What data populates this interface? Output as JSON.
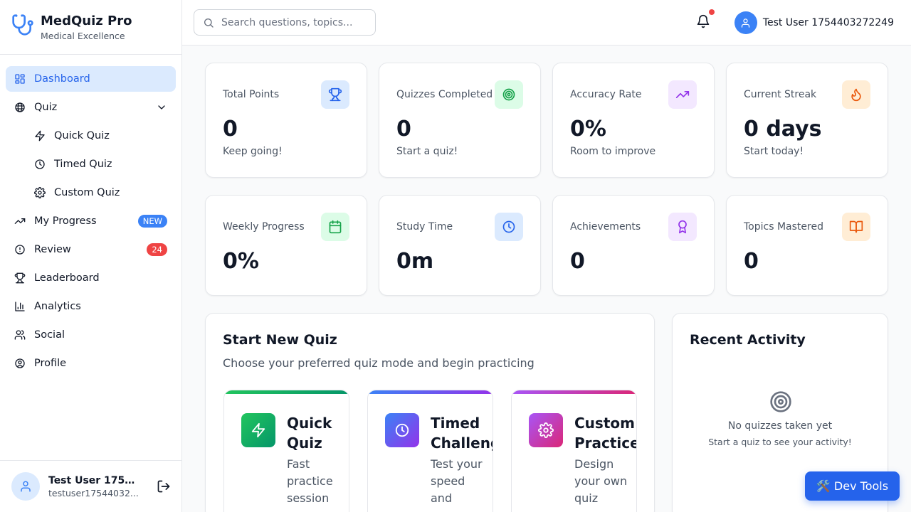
{
  "brand": {
    "title": "MedQuiz Pro",
    "subtitle": "Medical Excellence",
    "icon": "stethoscope-icon"
  },
  "sidebar": {
    "items": [
      {
        "label": "Dashboard",
        "icon": "dashboard-icon",
        "active": true
      },
      {
        "label": "Quiz",
        "icon": "brain-icon",
        "expanded": true
      },
      {
        "label": "Quick Quiz",
        "icon": "zap-icon",
        "sub": true
      },
      {
        "label": "Timed Quiz",
        "icon": "clock-icon",
        "sub": true
      },
      {
        "label": "Custom Quiz",
        "icon": "gear-icon",
        "sub": true
      },
      {
        "label": "My Progress",
        "icon": "trending-up-icon",
        "badge": "NEW"
      },
      {
        "label": "Review",
        "icon": "alert-circle-icon",
        "badge": "24"
      },
      {
        "label": "Leaderboard",
        "icon": "trophy-icon"
      },
      {
        "label": "Analytics",
        "icon": "bar-chart-icon"
      },
      {
        "label": "Social",
        "icon": "users-icon"
      },
      {
        "label": "Profile",
        "icon": "user-circle-icon"
      }
    ],
    "footer": {
      "name": "Test User 17544...",
      "email": "testuser17544032..."
    }
  },
  "header": {
    "search_placeholder": "Search questions, topics...",
    "user_name": "Test User 1754403272249",
    "has_notification": true
  },
  "stats": [
    {
      "label": "Total Points",
      "value": "0",
      "sub": "Keep going!",
      "icon": "trophy-icon",
      "color": "blue"
    },
    {
      "label": "Quizzes Completed",
      "value": "0",
      "sub": "Start a quiz!",
      "icon": "target-icon",
      "color": "green"
    },
    {
      "label": "Accuracy Rate",
      "value": "0%",
      "sub": "Room to improve",
      "icon": "trending-up-icon",
      "color": "purple"
    },
    {
      "label": "Current Streak",
      "value": "0 days",
      "sub": "Start today!",
      "icon": "flame-icon",
      "color": "orange"
    },
    {
      "label": "Weekly Progress",
      "value": "0%",
      "icon": "calendar-icon",
      "color": "green"
    },
    {
      "label": "Study Time",
      "value": "0m",
      "icon": "clock-icon",
      "color": "blue"
    },
    {
      "label": "Achievements",
      "value": "0",
      "icon": "award-icon",
      "color": "purple"
    },
    {
      "label": "Topics Mastered",
      "value": "0",
      "icon": "book-icon",
      "color": "orange"
    }
  ],
  "start_quiz": {
    "title": "Start New Quiz",
    "subtitle": "Choose your preferred quiz mode and begin practicing",
    "modes": [
      {
        "title": "Quick Quiz",
        "desc": "Fast practice session",
        "icon": "zap-icon",
        "gradient": [
          "#22c55e",
          "#059669"
        ]
      },
      {
        "title": "Timed Challenge",
        "desc": "Test your speed and accuracy",
        "icon": "clock-icon",
        "gradient": [
          "#3b82f6",
          "#9333ea"
        ]
      },
      {
        "title": "Custom Practice",
        "desc": "Design your own quiz",
        "icon": "gear-icon",
        "gradient": [
          "#a855f7",
          "#db2777"
        ]
      }
    ]
  },
  "recent_activity": {
    "title": "Recent Activity",
    "empty_title": "No quizzes taken yet",
    "empty_sub": "Start a quiz to see your activity!",
    "icon": "target-icon"
  },
  "devtools": {
    "label": "🛠️ Dev Tools"
  }
}
